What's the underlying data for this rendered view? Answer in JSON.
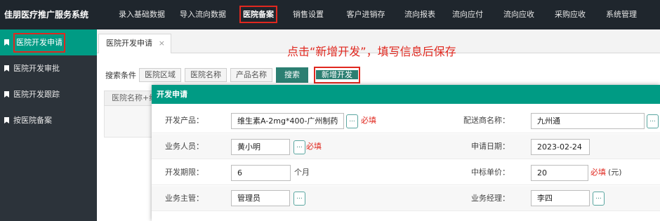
{
  "app": {
    "title": "佳朋医疗推广服务系统"
  },
  "nav": {
    "items": [
      {
        "label": "录入基础数据"
      },
      {
        "label": "导入流向数据"
      },
      {
        "label": "医院备案"
      },
      {
        "label": "销售设置"
      },
      {
        "label": "客户进销存"
      },
      {
        "label": "流向报表"
      },
      {
        "label": "流向应付"
      },
      {
        "label": "流向应收"
      },
      {
        "label": "采购应收"
      },
      {
        "label": "系统管理"
      }
    ],
    "active_index": 2
  },
  "sidebar": {
    "items": [
      {
        "label": "医院开发申请"
      },
      {
        "label": "医院开发审批"
      },
      {
        "label": "医院开发跟踪"
      },
      {
        "label": "按医院备案"
      }
    ]
  },
  "tabs": {
    "items": [
      {
        "label": "医院开发申请",
        "close": "×"
      }
    ]
  },
  "annotation": "点击“新增开发”，填写信息后保存",
  "search": {
    "label": "搜索条件",
    "filters": [
      "医院区域",
      "医院名称",
      "产品名称"
    ],
    "search_button": "搜索",
    "add_button": "新增开发"
  },
  "grid": {
    "header_text": "医院名称+级"
  },
  "modal": {
    "title": "开发申请",
    "pick_glyph": "...",
    "required_text": "必填",
    "fields": {
      "product": {
        "label": "开发产品：",
        "value": "维生素A-2mg*400-广州制药"
      },
      "distributor": {
        "label": "配送商名称：",
        "value": "九州通"
      },
      "salesperson": {
        "label": "业务人员：",
        "value": "黄小明"
      },
      "apply_date": {
        "label": "申请日期：",
        "value": "2023-02-24"
      },
      "period": {
        "label": "开发期限：",
        "value": "6",
        "unit": "个月"
      },
      "bid_price": {
        "label": "中标单价：",
        "value": "20",
        "unit": "(元)"
      },
      "supervisor": {
        "label": "业务主管：",
        "value": "管理员"
      },
      "manager": {
        "label": "业务经理：",
        "value": "李四"
      }
    }
  },
  "colors": {
    "accent": "#009b84",
    "topbar": "#1f262d",
    "sidebar": "#2c333a",
    "highlight": "#e0281f"
  }
}
